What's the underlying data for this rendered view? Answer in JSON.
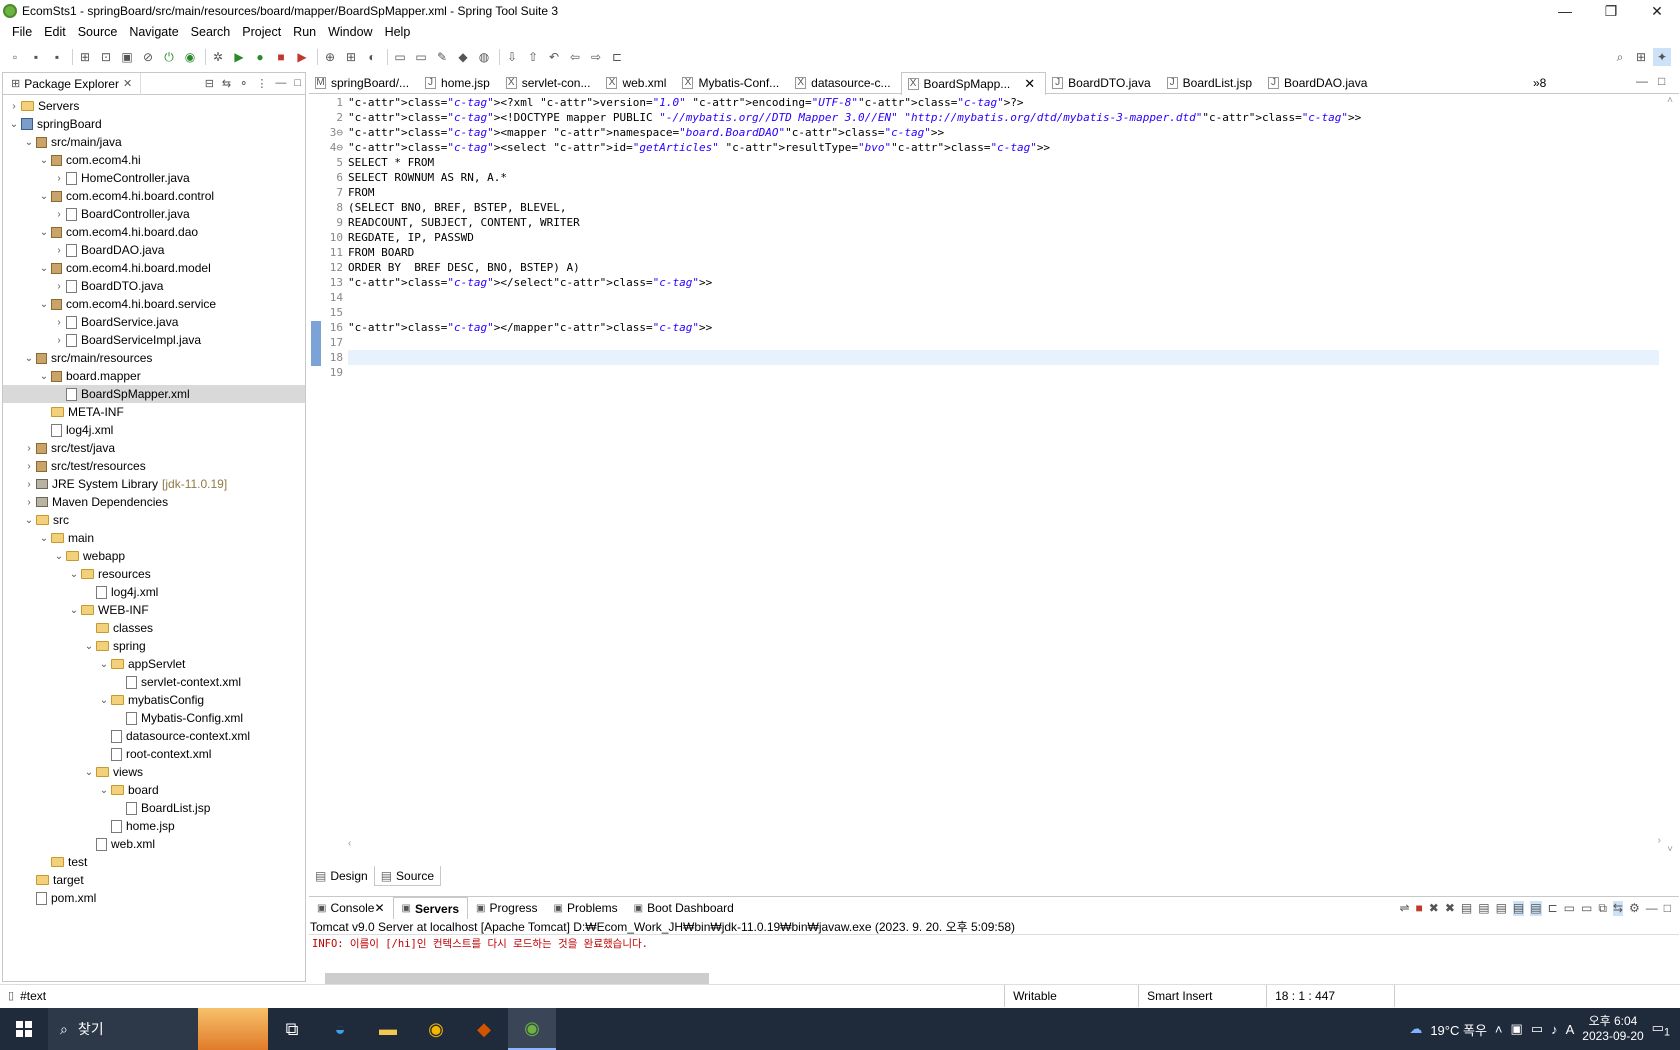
{
  "window": {
    "title": "EcomSts1 - springBoard/src/main/resources/board/mapper/BoardSpMapper.xml - Spring Tool Suite 3"
  },
  "menu": [
    "File",
    "Edit",
    "Source",
    "Navigate",
    "Search",
    "Project",
    "Run",
    "Window",
    "Help"
  ],
  "package_explorer": {
    "title": "Package Explorer",
    "items": [
      {
        "label": "Servers",
        "depth": 0,
        "twisty": "›",
        "icon": "folder"
      },
      {
        "label": "springBoard",
        "depth": 0,
        "twisty": "⌄",
        "icon": "proj"
      },
      {
        "label": "src/main/java",
        "depth": 1,
        "twisty": "⌄",
        "icon": "pkg"
      },
      {
        "label": "com.ecom4.hi",
        "depth": 2,
        "twisty": "⌄",
        "icon": "pkg"
      },
      {
        "label": "HomeController.java",
        "depth": 3,
        "twisty": "›",
        "icon": "java"
      },
      {
        "label": "com.ecom4.hi.board.control",
        "depth": 2,
        "twisty": "⌄",
        "icon": "pkg"
      },
      {
        "label": "BoardController.java",
        "depth": 3,
        "twisty": "›",
        "icon": "java"
      },
      {
        "label": "com.ecom4.hi.board.dao",
        "depth": 2,
        "twisty": "⌄",
        "icon": "pkg"
      },
      {
        "label": "BoardDAO.java",
        "depth": 3,
        "twisty": "›",
        "icon": "java"
      },
      {
        "label": "com.ecom4.hi.board.model",
        "depth": 2,
        "twisty": "⌄",
        "icon": "pkg"
      },
      {
        "label": "BoardDTO.java",
        "depth": 3,
        "twisty": "›",
        "icon": "java"
      },
      {
        "label": "com.ecom4.hi.board.service",
        "depth": 2,
        "twisty": "⌄",
        "icon": "pkg"
      },
      {
        "label": "BoardService.java",
        "depth": 3,
        "twisty": "›",
        "icon": "java"
      },
      {
        "label": "BoardServiceImpl.java",
        "depth": 3,
        "twisty": "›",
        "icon": "java"
      },
      {
        "label": "src/main/resources",
        "depth": 1,
        "twisty": "⌄",
        "icon": "pkg"
      },
      {
        "label": "board.mapper",
        "depth": 2,
        "twisty": "⌄",
        "icon": "pkg"
      },
      {
        "label": "BoardSpMapper.xml",
        "depth": 3,
        "twisty": "",
        "icon": "xml",
        "selected": true
      },
      {
        "label": "META-INF",
        "depth": 2,
        "twisty": "",
        "icon": "folder"
      },
      {
        "label": "log4j.xml",
        "depth": 2,
        "twisty": "",
        "icon": "xml"
      },
      {
        "label": "src/test/java",
        "depth": 1,
        "twisty": "›",
        "icon": "pkg"
      },
      {
        "label": "src/test/resources",
        "depth": 1,
        "twisty": "›",
        "icon": "pkg"
      },
      {
        "label": "JRE System Library",
        "suffix": "[jdk-11.0.19]",
        "depth": 1,
        "twisty": "›",
        "icon": "lib"
      },
      {
        "label": "Maven Dependencies",
        "depth": 1,
        "twisty": "›",
        "icon": "lib"
      },
      {
        "label": "src",
        "depth": 1,
        "twisty": "⌄",
        "icon": "folder"
      },
      {
        "label": "main",
        "depth": 2,
        "twisty": "⌄",
        "icon": "folder"
      },
      {
        "label": "webapp",
        "depth": 3,
        "twisty": "⌄",
        "icon": "folder"
      },
      {
        "label": "resources",
        "depth": 4,
        "twisty": "⌄",
        "icon": "folder"
      },
      {
        "label": "log4j.xml",
        "depth": 5,
        "twisty": "",
        "icon": "xml"
      },
      {
        "label": "WEB-INF",
        "depth": 4,
        "twisty": "⌄",
        "icon": "folder"
      },
      {
        "label": "classes",
        "depth": 5,
        "twisty": "",
        "icon": "folder"
      },
      {
        "label": "spring",
        "depth": 5,
        "twisty": "⌄",
        "icon": "folder"
      },
      {
        "label": "appServlet",
        "depth": 6,
        "twisty": "⌄",
        "icon": "folder"
      },
      {
        "label": "servlet-context.xml",
        "depth": 7,
        "twisty": "",
        "icon": "xml"
      },
      {
        "label": "mybatisConfig",
        "depth": 6,
        "twisty": "⌄",
        "icon": "folder"
      },
      {
        "label": "Mybatis-Config.xml",
        "depth": 7,
        "twisty": "",
        "icon": "xml"
      },
      {
        "label": "datasource-context.xml",
        "depth": 6,
        "twisty": "",
        "icon": "xml"
      },
      {
        "label": "root-context.xml",
        "depth": 6,
        "twisty": "",
        "icon": "xml"
      },
      {
        "label": "views",
        "depth": 5,
        "twisty": "⌄",
        "icon": "folder"
      },
      {
        "label": "board",
        "depth": 6,
        "twisty": "⌄",
        "icon": "folder"
      },
      {
        "label": "BoardList.jsp",
        "depth": 7,
        "twisty": "",
        "icon": "java"
      },
      {
        "label": "home.jsp",
        "depth": 6,
        "twisty": "",
        "icon": "java"
      },
      {
        "label": "web.xml",
        "depth": 5,
        "twisty": "",
        "icon": "xml"
      },
      {
        "label": "test",
        "depth": 2,
        "twisty": "",
        "icon": "folder"
      },
      {
        "label": "target",
        "depth": 1,
        "twisty": "",
        "icon": "folder"
      },
      {
        "label": "pom.xml",
        "depth": 1,
        "twisty": "",
        "icon": "xml"
      }
    ]
  },
  "editor_tabs": [
    {
      "label": "springBoard/...",
      "icon": "M"
    },
    {
      "label": "home.jsp",
      "icon": "J"
    },
    {
      "label": "servlet-con...",
      "icon": "X"
    },
    {
      "label": "web.xml",
      "icon": "X"
    },
    {
      "label": "Mybatis-Conf...",
      "icon": "X"
    },
    {
      "label": "datasource-c...",
      "icon": "X"
    },
    {
      "label": "BoardSpMapp...",
      "icon": "X",
      "active": true
    },
    {
      "label": "BoardDTO.java",
      "icon": "J"
    },
    {
      "label": "BoardList.jsp",
      "icon": "J"
    },
    {
      "label": "BoardDAO.java",
      "icon": "J"
    }
  ],
  "editor_tabs_overflow": "»8",
  "code_lines": [
    "<?xml version=\"1.0\" encoding=\"UTF-8\"?>",
    "<!DOCTYPE mapper PUBLIC \"-//mybatis.org//DTD Mapper 3.0//EN\" \"http://mybatis.org/dtd/mybatis-3-mapper.dtd\">",
    "<mapper namespace=\"board.BoardDAO\">",
    "<select id=\"getArticles\" resultType=\"bvo\">",
    "SELECT * FROM",
    "SELECT ROWNUM AS RN, A.*",
    "FROM",
    "(SELECT BNO, BREF, BSTEP, BLEVEL,",
    "READCOUNT, SUBJECT, CONTENT, WRITER",
    "REGDATE, IP, PASSWD",
    "FROM BOARD",
    "ORDER BY  BREF DESC, BNO, BSTEP) A)",
    "</select>",
    "",
    "",
    "</mapper>",
    "",
    "",
    ""
  ],
  "line_numbers": [
    "1",
    "2",
    "3⊖",
    "4⊖",
    "5",
    "6",
    "7",
    "8",
    "9",
    "10",
    "11",
    "12",
    "13",
    "14",
    "15",
    "16",
    "17",
    "18",
    "19"
  ],
  "editor_bottom_tabs": [
    {
      "label": "Design"
    },
    {
      "label": "Source",
      "active": true
    }
  ],
  "console": {
    "tabs": [
      {
        "label": "Console"
      },
      {
        "label": "Servers",
        "active": true
      },
      {
        "label": "Progress"
      },
      {
        "label": "Problems"
      },
      {
        "label": "Boot Dashboard"
      }
    ],
    "header": "Tomcat v9.0 Server at localhost [Apache Tomcat] D:₩Ecom_Work_JH₩bin₩jdk-11.0.19₩bin₩javaw.exe  (2023. 9. 20. 오후 5:09:58)",
    "line": "INFO: 이름이 [/hi]인 컨텍스트를 다시 로드하는 것을 완료했습니다."
  },
  "status": {
    "left": "#text",
    "writable": "Writable",
    "insert": "Smart Insert",
    "position": "18 : 1 : 447"
  },
  "taskbar": {
    "search_placeholder": "찾기",
    "weather": "19°C  폭우",
    "time": "오후 6:04",
    "date": "2023-09-20",
    "ime": "A",
    "notification_count": "1"
  }
}
